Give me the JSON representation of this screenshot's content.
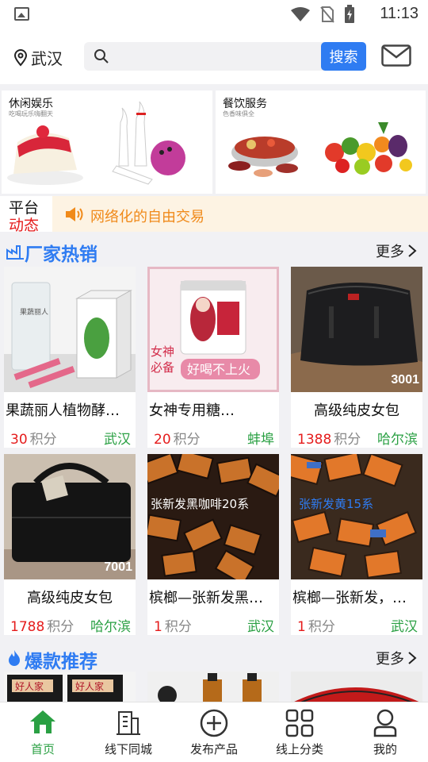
{
  "status_bar": {
    "time": "11:13"
  },
  "header": {
    "location": "武汉",
    "search_placeholder": "",
    "search_button": "搜索"
  },
  "category_banners": [
    {
      "title": "休闲娱乐",
      "subtitle": "吃喝玩乐嗨翻天"
    },
    {
      "title": "餐饮服务",
      "subtitle": "色香味俱全"
    }
  ],
  "notice": {
    "tag_line1": "平台",
    "tag_line2": "动态",
    "text": "网络化的自由交易"
  },
  "factory_section": {
    "title": "厂家热销",
    "more": "更多"
  },
  "factory_products": [
    {
      "name": "果蔬丽人植物酵…",
      "price": "30",
      "unit": "积分",
      "city": "武汉",
      "corner": "",
      "center": false
    },
    {
      "name": "女神专用糖…",
      "price": "20",
      "unit": "积分",
      "city": "蚌埠",
      "corner": "",
      "center": false
    },
    {
      "name": "高级纯皮女包",
      "price": "1388",
      "unit": "积分",
      "city": "哈尔滨",
      "corner": "3001",
      "center": true
    },
    {
      "name": "高级纯皮女包",
      "price": "1788",
      "unit": "积分",
      "city": "哈尔滨",
      "corner": "7001",
      "center": true
    },
    {
      "name": "槟榔—张新发黑…",
      "price": "1",
      "unit": "积分",
      "city": "武汉",
      "corner": "",
      "center": false
    },
    {
      "name": "槟榔—张新发，…",
      "price": "1",
      "unit": "积分",
      "city": "武汉",
      "corner": "",
      "center": false
    }
  ],
  "product_image_text": {
    "box_text": "果蔬丽人",
    "candy_slogan1": "女神",
    "candy_slogan2": "必备",
    "candy_banner": "好喝不上火",
    "betel_black": "张新发黑咖啡20系",
    "betel_blue": "张新发黄15系"
  },
  "hot_section": {
    "title": "爆款推荐",
    "more": "更多"
  },
  "hot_thumb_label": "好人家",
  "tabs": [
    {
      "label": "首页",
      "icon": "home-icon",
      "active": true
    },
    {
      "label": "线下同城",
      "icon": "building-icon",
      "active": false
    },
    {
      "label": "发布产品",
      "icon": "plus-circle-icon",
      "active": false
    },
    {
      "label": "线上分类",
      "icon": "grid-icon",
      "active": false
    },
    {
      "label": "我的",
      "icon": "user-icon",
      "active": false
    }
  ],
  "colors": {
    "accent_blue": "#2f7cf2",
    "price_red": "#e51c1c",
    "city_green": "#2aa043",
    "notice_orange": "#f08a1a",
    "notice_bg": "#fdf3e3"
  }
}
